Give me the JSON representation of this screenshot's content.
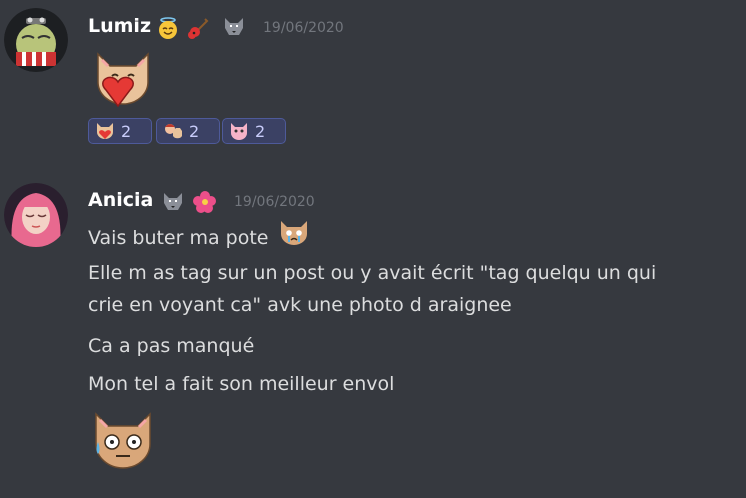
{
  "messages": [
    {
      "author": "Lumiz",
      "timestamp": "19/06/2020",
      "badges": [
        "angel-face-emoji",
        "guitar-emoji",
        "wolf-emoji"
      ],
      "reactions": [
        {
          "emoji": "cat-heart-sticker",
          "count": "2"
        },
        {
          "emoji": "cat-girl-sticker",
          "count": "2"
        },
        {
          "emoji": "pink-cat-sticker",
          "count": "2"
        }
      ]
    },
    {
      "author": "Anicia",
      "timestamp": "19/06/2020",
      "badges": [
        "wolf-emoji",
        "hibiscus-emoji"
      ],
      "lines": [
        "Vais buter ma pote",
        "Elle m as tag sur un post ou y avait écrit \"tag quelqu un qui",
        "crie en voyant ca\" avk une photo d araignee",
        "Ca a pas manqué",
        "Mon tel a fait son meilleur envol"
      ]
    }
  ],
  "colors": {
    "background": "#36393f",
    "text": "#dcddde",
    "timestamp": "#72767d",
    "reaction_bg": "#3b4164",
    "reaction_border": "#4e5a9a"
  }
}
